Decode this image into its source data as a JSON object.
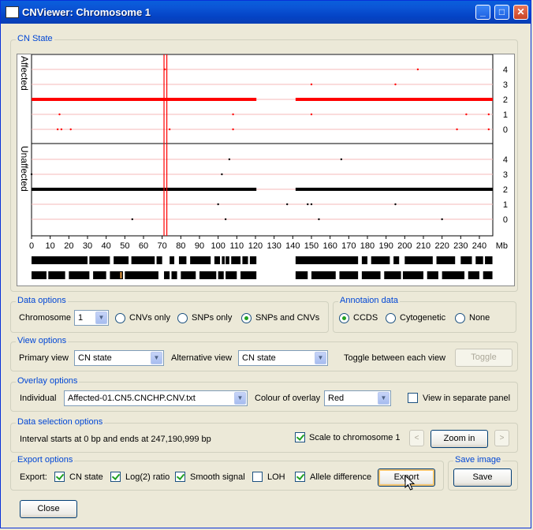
{
  "window": {
    "title": "CNViewer: Chromosome 1"
  },
  "cn_state": {
    "legend": "CN State",
    "affected_label": "Affected",
    "unaffected_label": "Unaffected",
    "y_ticks_affected": [
      "4",
      "3",
      "2",
      "1",
      "0"
    ],
    "y_ticks_unaffected": [
      "4",
      "3",
      "2",
      "1",
      "0"
    ],
    "x_ticks": [
      "0",
      "10",
      "20",
      "30",
      "40",
      "50",
      "60",
      "70",
      "80",
      "90",
      "100",
      "110",
      "120",
      "130",
      "140",
      "150",
      "160",
      "170",
      "180",
      "190",
      "200",
      "210",
      "220",
      "230",
      "240"
    ],
    "x_unit": "Mb"
  },
  "data_options": {
    "legend": "Data options",
    "chromosome_label": "Chromosome",
    "chromosome_value": "1",
    "radios": [
      {
        "label": "CNVs only",
        "checked": false
      },
      {
        "label": "SNPs only",
        "checked": false
      },
      {
        "label": "SNPs and CNVs",
        "checked": true
      }
    ]
  },
  "annotation": {
    "legend": "Annotaion data",
    "radios": [
      {
        "label": "CCDS",
        "checked": true
      },
      {
        "label": "Cytogenetic",
        "checked": false
      },
      {
        "label": "None",
        "checked": false
      }
    ]
  },
  "view_options": {
    "legend": "View options",
    "primary_label": "Primary view",
    "primary_value": "CN state",
    "alternative_label": "Alternative view",
    "alternative_value": "CN state",
    "toggle_text": "Toggle between each view",
    "toggle_button": "Toggle"
  },
  "overlay_options": {
    "legend": "Overlay options",
    "individual_label": "Individual",
    "individual_value": "Affected-01.CN5.CNCHP.CNV.txt",
    "colour_label": "Colour of overlay",
    "colour_value": "Red",
    "separate_label": "View in separate panel",
    "separate_checked": false
  },
  "data_selection": {
    "legend": "Data selection options",
    "interval_text": "Interval starts at 0 bp and ends at 247,190,999 bp",
    "scale_label": "Scale to chromosome 1",
    "scale_checked": true,
    "prev_glyph": "<",
    "zoom_button": "Zoom in",
    "next_glyph": ">"
  },
  "export_options": {
    "legend": "Export options",
    "export_label": "Export:",
    "checks": [
      {
        "label": "CN state",
        "checked": true
      },
      {
        "label": "Log(2) ratio",
        "checked": true
      },
      {
        "label": "Smooth signal",
        "checked": true
      },
      {
        "label": "LOH",
        "checked": false
      },
      {
        "label": "Allele difference",
        "checked": true
      }
    ],
    "export_button": "Export"
  },
  "save_image": {
    "legend": "Save image",
    "save_button": "Save"
  },
  "close_button": "Close",
  "colors": {
    "affected": "#ff0000",
    "unaffected": "#000000",
    "gridline": "#f4b8b8",
    "legend_text": "#0046d5"
  }
}
